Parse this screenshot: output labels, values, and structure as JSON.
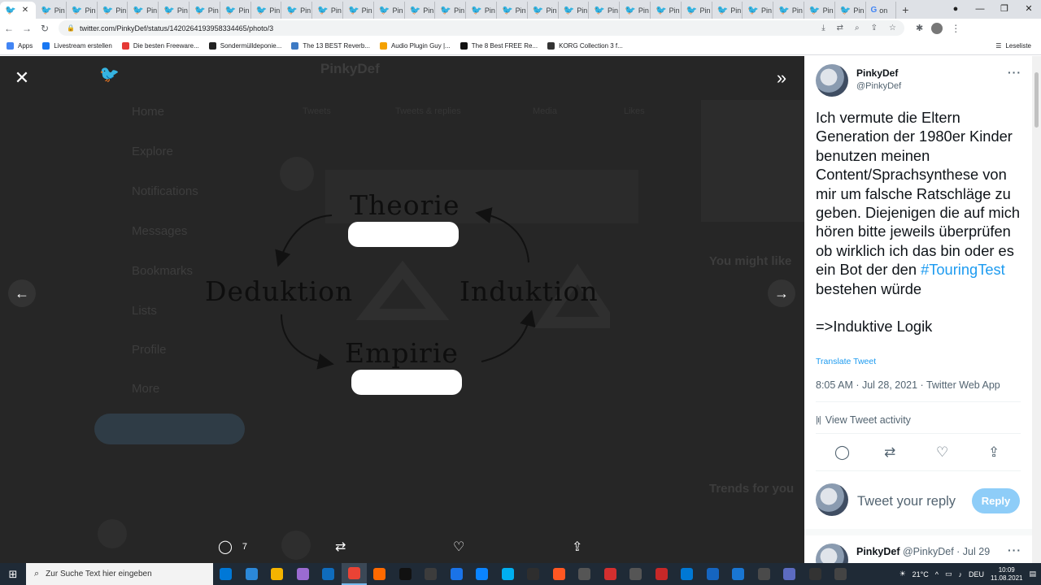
{
  "browser": {
    "tabs": [
      {
        "label": "",
        "icon": "twitter-icon",
        "active": true
      },
      {
        "label": "Pin",
        "icon": "twitter-icon"
      },
      {
        "label": "Pin",
        "icon": "twitter-icon"
      },
      {
        "label": "Pin",
        "icon": "twitter-icon"
      },
      {
        "label": "Pin",
        "icon": "twitter-icon"
      },
      {
        "label": "Pin",
        "icon": "twitter-icon"
      },
      {
        "label": "Pin",
        "icon": "twitter-icon"
      },
      {
        "label": "Pin",
        "icon": "twitter-icon"
      },
      {
        "label": "Pin",
        "icon": "twitter-icon"
      },
      {
        "label": "Pin",
        "icon": "twitter-icon"
      },
      {
        "label": "Pin",
        "icon": "twitter-icon"
      },
      {
        "label": "Pin",
        "icon": "twitter-icon"
      },
      {
        "label": "Pin",
        "icon": "twitter-icon"
      },
      {
        "label": "Pin",
        "icon": "twitter-icon"
      },
      {
        "label": "Pin",
        "icon": "twitter-icon"
      },
      {
        "label": "Pin",
        "icon": "twitter-icon"
      },
      {
        "label": "Pin",
        "icon": "twitter-icon"
      },
      {
        "label": "Pin",
        "icon": "twitter-icon"
      },
      {
        "label": "Pin",
        "icon": "twitter-icon"
      },
      {
        "label": "Pin",
        "icon": "twitter-icon"
      },
      {
        "label": "Pin",
        "icon": "twitter-icon"
      },
      {
        "label": "Pin",
        "icon": "twitter-icon"
      },
      {
        "label": "Pin",
        "icon": "twitter-icon"
      },
      {
        "label": "Pin",
        "icon": "twitter-icon"
      },
      {
        "label": "Pin",
        "icon": "twitter-icon"
      },
      {
        "label": "Pin",
        "icon": "twitter-icon"
      },
      {
        "label": "Pin",
        "icon": "twitter-icon"
      },
      {
        "label": "Pin",
        "icon": "twitter-icon"
      },
      {
        "label": "on",
        "icon": "google-icon"
      }
    ],
    "new_tab": "+",
    "url": "twitter.com/PinkyDef/status/1420264193958334465/photo/3",
    "bookmarks": [
      {
        "label": "Apps",
        "color": "#4285f4"
      },
      {
        "label": "Livestream erstellen",
        "color": "#1877f2"
      },
      {
        "label": "Die besten Freeware...",
        "color": "#e53935"
      },
      {
        "label": "Sondermülldeponie...",
        "color": "#222222"
      },
      {
        "label": "The 13 BEST Reverb...",
        "color": "#3d7ac4"
      },
      {
        "label": "Audio Plugin Guy |...",
        "color": "#f4a100"
      },
      {
        "label": "The 8 Best FREE Re...",
        "color": "#111111"
      },
      {
        "label": "KORG Collection 3 f...",
        "color": "#333333"
      }
    ],
    "reading_list": "Leseliste"
  },
  "background_page": {
    "profile_name": "PinkyDef",
    "nav": [
      "Home",
      "Explore",
      "Notifications",
      "Messages",
      "Bookmarks",
      "Lists",
      "Profile",
      "More"
    ],
    "tabs": [
      "Tweets",
      "Tweets & replies",
      "Media",
      "Likes"
    ],
    "sidebar_heading": "You might like",
    "trends_heading": "Trends for you"
  },
  "diagram": {
    "top": "Theorie",
    "left": "Deduktion",
    "right": "Induktion",
    "bottom": "Empirie"
  },
  "overlay_actions": {
    "reply_count": "7"
  },
  "tweet": {
    "author_name": "PinkyDef",
    "author_handle": "@PinkyDef",
    "text_before": "Ich vermute die Eltern Generation der 1980er Kinder benutzen meinen Content/Sprachsynthese von mir um falsche Ratschläge zu geben. Diejenigen die auf mich hören bitte jeweils überprüfen ob wirklich ich das bin oder es ein Bot der den ",
    "hashtag": "#TouringTest",
    "text_after": " bestehen würde",
    "logic_line": "=>Induktive Logik",
    "translate": "Translate Tweet",
    "timestamp": "8:05 AM · Jul 28, 2021 · Twitter Web App",
    "activity": "View Tweet activity",
    "reply_placeholder": "Tweet your reply",
    "reply_button": "Reply",
    "next_author_name": "PinkyDef",
    "next_author_meta": "@PinkyDef · Jul 29",
    "accent": "#1d9bf0"
  },
  "taskbar": {
    "search_placeholder": "Zur Suche Text hier eingeben",
    "apps": [
      {
        "color": "#0078d7"
      },
      {
        "color": "#2b88d8"
      },
      {
        "color": "#f4b400"
      },
      {
        "color": "#9b6bd1"
      },
      {
        "color": "#0f6cbd"
      },
      {
        "color": "#ea4335",
        "active": true
      },
      {
        "color": "#ff6a00"
      },
      {
        "color": "#111111"
      },
      {
        "color": "#3c3c3c"
      },
      {
        "color": "#1a73e8"
      },
      {
        "color": "#0a84ff"
      },
      {
        "color": "#00aff0"
      },
      {
        "color": "#2e2e2e"
      },
      {
        "color": "#ff5722"
      },
      {
        "color": "#555555"
      },
      {
        "color": "#d32f2f"
      },
      {
        "color": "#555555"
      },
      {
        "color": "#c62828"
      },
      {
        "color": "#0078d4"
      },
      {
        "color": "#1565c0"
      },
      {
        "color": "#1976d2"
      },
      {
        "color": "#4a4a4a"
      },
      {
        "color": "#5c6bc0"
      },
      {
        "color": "#333333"
      },
      {
        "color": "#444444"
      }
    ],
    "temperature": "21°C",
    "language": "DEU",
    "time": "10:09",
    "date": "11.08.2021"
  }
}
